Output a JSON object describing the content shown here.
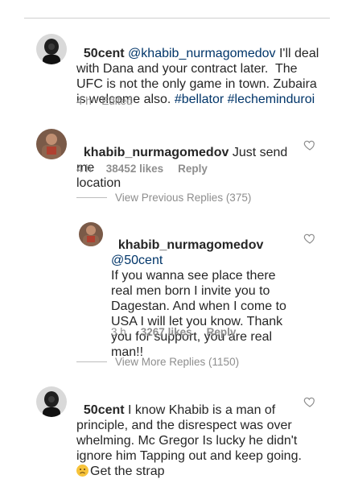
{
  "comments": [
    {
      "username": "50cent",
      "text_plain": "@khabib_nurmagomedov I'll deal with Dana and your contract later.  The UFC is not the only game in town. Zubaira is welcome also. ",
      "mention": "@khabib_nurmagomedov",
      "text_body": " I'll deal\nwith Dana and your contract later.  The\nUFC is not the only game in town. Zubaira\nis welcome also. ",
      "hashtags": "#bellator #lecheminduroi",
      "time": "4 h",
      "edited": "Edited",
      "sep": "·"
    },
    {
      "username": "khabib_nurmagomedov",
      "text_body": " Just send me\nlocation",
      "time": "4 h",
      "likes": "38452 likes",
      "reply": "Reply"
    }
  ],
  "view_previous": "View Previous Replies (375)",
  "reply_comment": {
    "username": "khabib_nurmagomedov",
    "mention": "@50cent",
    "text_body": "If you wanna see place there\nreal men born I invite you to\nDagestan. And when I come to\nUSA I will let you know. Thank\nyou for support, you are real\nman!!",
    "time": "3 h",
    "likes": "3267 likes",
    "reply": "Reply"
  },
  "view_more": "View More Replies (1150)",
  "last_comment": {
    "username": "50cent",
    "text_body": " I know Khabib is a man of\nprinciple, and the disrespect was over\nwhelming. Mc Gregor Is lucky he didn't\nignore him Tapping out and keep going.\n",
    "text_tail": "Get the strap"
  },
  "icons": {
    "like": "heart-outline-icon",
    "emoji": "sad-face-emoji-icon"
  },
  "colors": {
    "text": "#262626",
    "muted": "#8e8e8e",
    "link": "#003569"
  }
}
